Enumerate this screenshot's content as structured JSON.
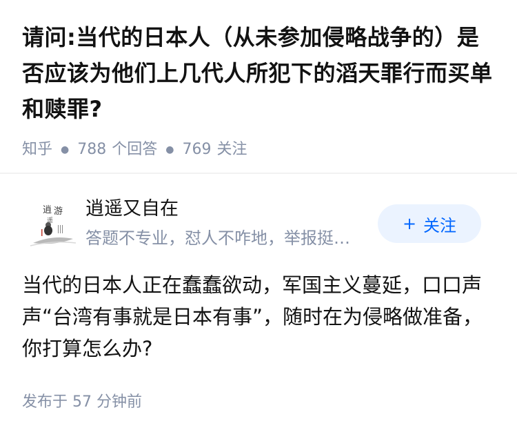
{
  "question": {
    "title": "请问:当代的日本人（从未参加侵略战争的）是否应该为他们上几代人所犯下的滔天罪行而买单和赎罪?",
    "source": "知乎",
    "answer_count": "788",
    "answer_label": "个回答",
    "follow_count": "769",
    "follow_label": "关注"
  },
  "author": {
    "name": "逍遥又自在",
    "bio": "答题不专业，怼人不咋地，举报挺…",
    "avatar_text": "逍遥游",
    "follow_button": {
      "plus": "+",
      "label": "关注"
    }
  },
  "answer": {
    "text": "当代的日本人正在蠢蠢欲动，军国主义蔓延，口口声声“台湾有事就是日本有事”，随时在为侵略做准备，你打算怎么办?"
  },
  "footer": {
    "published_label": "发布于",
    "published_value": "57 分钟前"
  },
  "colors": {
    "title": "#121212",
    "meta": "#8590a6",
    "accent": "#0066ff",
    "follow_bg": "#ebf3ff"
  }
}
